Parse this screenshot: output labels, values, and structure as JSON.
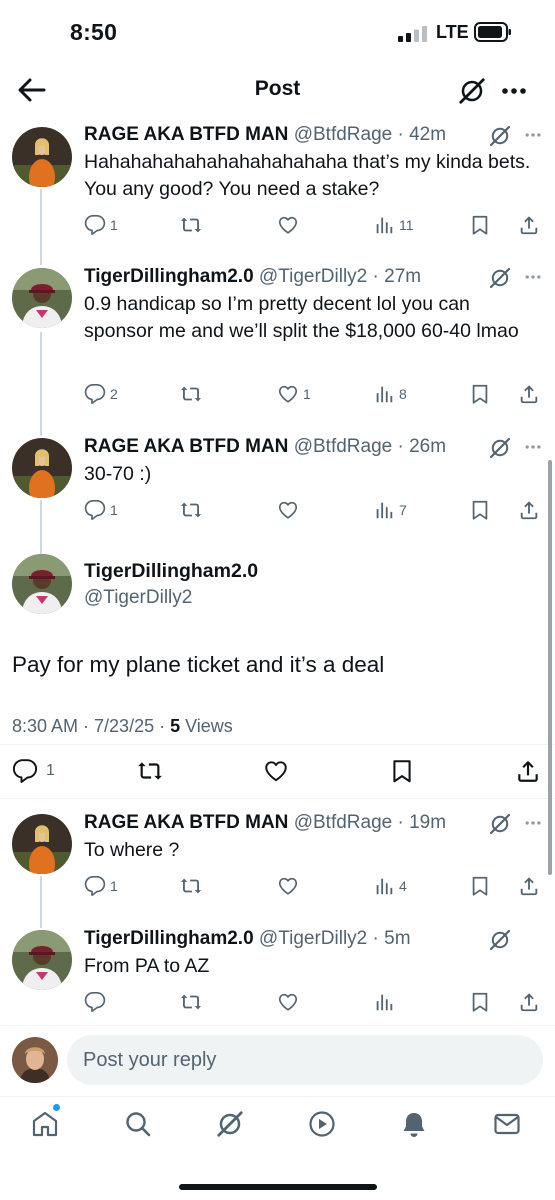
{
  "status_bar": {
    "time": "8:50",
    "network": "LTE"
  },
  "header": {
    "title": "Post"
  },
  "replies_above": [
    {
      "name": "RAGE AKA BTFD MAN",
      "meta": "@BtfdRage · 42m",
      "text": "Hahahahahahahahahahahaha that’s my kinda bets. You any good? You need a stake?",
      "replies": "1",
      "reposts": "",
      "likes": "",
      "views": "11"
    },
    {
      "name": "TigerDillingham2.0",
      "meta": "@TigerDilly2 · 27m",
      "text": "0.9 handicap so I’m pretty decent lol you can sponsor me and we’ll split the $18,000 60-40 lmao",
      "replies": "2",
      "reposts": "",
      "likes": "1",
      "views": "8"
    },
    {
      "name": "RAGE AKA BTFD MAN",
      "meta": "@BtfdRage · 26m",
      "text": "30-70 :)",
      "replies": "1",
      "reposts": "",
      "likes": "",
      "views": "7"
    }
  ],
  "main_post": {
    "name": "TigerDillingham2.0",
    "handle": "@TigerDilly2",
    "text": "Pay for my plane ticket and it’s a deal",
    "timestamp": "8:30 AM · 7/23/25 · ",
    "views_count": "5",
    "views_label": " Views",
    "replies": "1"
  },
  "replies_below": [
    {
      "name": "RAGE AKA BTFD MAN",
      "meta": "@BtfdRage · 19m",
      "text": "To where ?",
      "replies": "1",
      "reposts": "",
      "likes": "",
      "views": "4"
    },
    {
      "name": "TigerDillingham2.0",
      "meta": "@TigerDilly2 · 5m",
      "text": "From PA to AZ",
      "replies": "",
      "reposts": "",
      "likes": "",
      "views": ""
    }
  ],
  "composer": {
    "placeholder": "Post your reply"
  },
  "colors": {
    "text": "#0f1419",
    "secondary": "#536471",
    "accent": "#1d9bf0",
    "divider": "#eff3f4"
  },
  "icons": {
    "header": [
      "back-arrow-icon",
      "grok-icon",
      "more-icon"
    ],
    "post_actions": [
      "reply-icon",
      "repost-icon",
      "like-icon",
      "views-icon",
      "bookmark-icon",
      "share-icon"
    ],
    "nav": [
      "home-icon",
      "search-icon",
      "grok-icon",
      "video-icon",
      "notifications-icon",
      "messages-icon"
    ]
  }
}
